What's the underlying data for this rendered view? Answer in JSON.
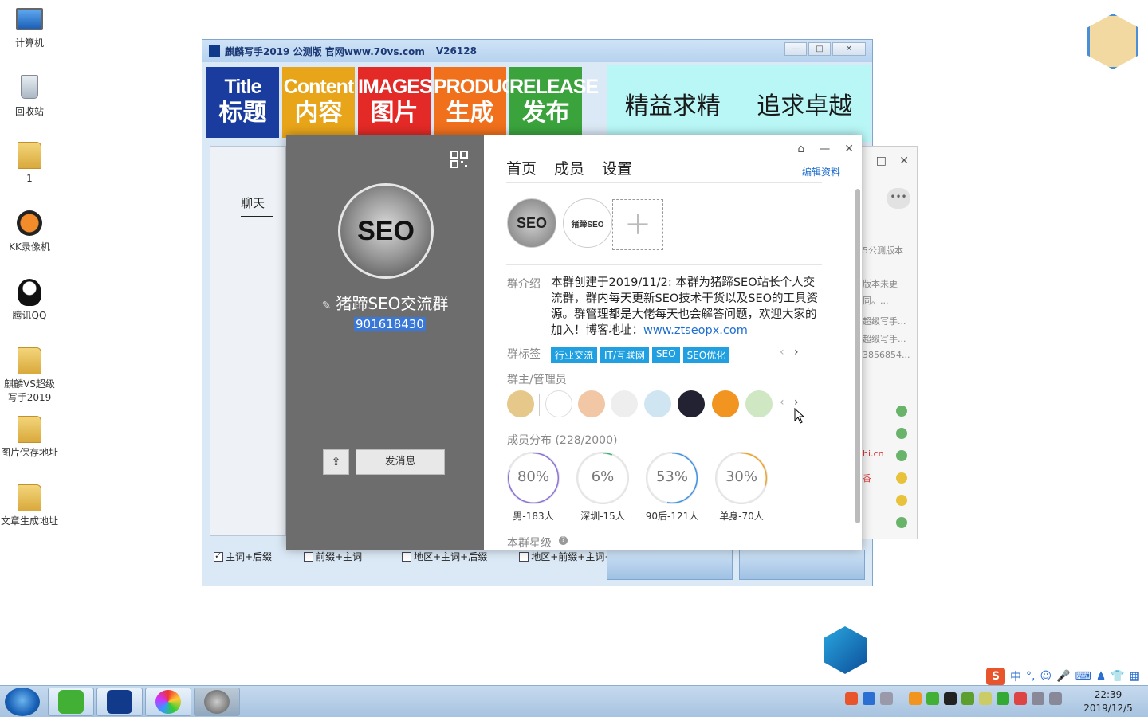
{
  "desktop": {
    "icons": [
      {
        "label": "计算机"
      },
      {
        "label": "回收站"
      },
      {
        "label": "1"
      },
      {
        "label": "KK录像机"
      },
      {
        "label": "腾讯QQ"
      },
      {
        "label": "麒麟VS超级写手2019"
      },
      {
        "label": "图片保存地址"
      },
      {
        "label": "文章生成地址"
      }
    ]
  },
  "writer": {
    "title": "麒麟写手2019 公测版 官网www.70vs.com",
    "version": "V26128",
    "tiles": [
      {
        "en": "Title",
        "cn": "标题",
        "color": "#1a3c9e"
      },
      {
        "en": "Content",
        "cn": "内容",
        "color": "#e8a51a"
      },
      {
        "en": "IMAGES",
        "cn": "图片",
        "color": "#e32a26"
      },
      {
        "en": "PRODUCT..",
        "cn": "生成",
        "color": "#f0701c"
      },
      {
        "en": "RELEASE",
        "cn": "发布",
        "color": "#3aa33c"
      }
    ],
    "slogan_left": "精益求精",
    "slogan_right": "追求卓越",
    "bottom_options": [
      {
        "label": "主词+后缀",
        "checked": true
      },
      {
        "label": "前缀+主词",
        "checked": false
      },
      {
        "label": "地区+主词+后缀",
        "checked": false
      },
      {
        "label": "地区+前缀+主词+后缀",
        "checked": false
      }
    ]
  },
  "chat": {
    "tab_label": "聊天"
  },
  "right_panel": {
    "lines": [
      "5公测版本",
      "版本未更",
      "同。...",
      "超级写手...",
      "超级写手...",
      "3856854...",
      "hi.cn",
      "香"
    ]
  },
  "group_card": {
    "name": "猪蹄SEO交流群",
    "group_id": "901618430",
    "avatar_text": "SEO",
    "send_message": "发消息",
    "tabs": [
      {
        "label": "首页",
        "active": true
      },
      {
        "label": "成员",
        "active": false
      },
      {
        "label": "设置",
        "active": false
      }
    ],
    "edit_profile": "编辑资料",
    "admin_avatars": [
      {
        "text": "SEO"
      },
      {
        "text": "猪蹄SEO"
      }
    ],
    "intro_label": "群介绍",
    "intro_text": "本群创建于2019/11/2: 本群为猪蹄SEO站长个人交流群，群内每天更新SEO技术干货以及SEO的工具资源。群管理都是大佬每天也会解答问题，欢迎大家的加入！博客地址：",
    "intro_link": "www.ztseopx.com",
    "tags_label": "群标签",
    "tags": [
      "行业交流",
      "IT/互联网",
      "SEO",
      "SEO优化"
    ],
    "owners_label": "群主/管理员",
    "distribution_label": "成员分布 (228/2000)",
    "distribution": [
      {
        "percent": "80%",
        "label": "男-183人",
        "value": 0.8,
        "color": "#8a6fd6"
      },
      {
        "percent": "6%",
        "label": "深圳-15人",
        "value": 0.06,
        "color": "#36b36a"
      },
      {
        "percent": "53%",
        "label": "90后-121人",
        "value": 0.53,
        "color": "#3a8ee6"
      },
      {
        "percent": "30%",
        "label": "单身-70人",
        "value": 0.3,
        "color": "#f0a020"
      }
    ],
    "level_label": "本群星级"
  },
  "ime": {
    "mode": "中"
  },
  "taskbar": {
    "time": "22:39",
    "date": "2019/12/5"
  }
}
